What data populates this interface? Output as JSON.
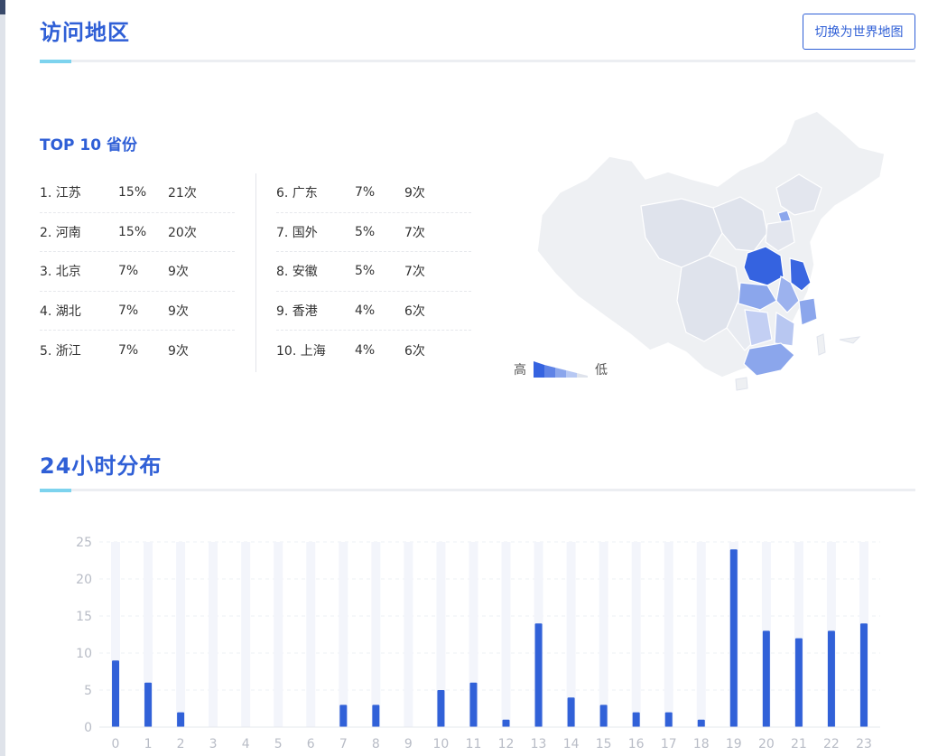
{
  "region": {
    "title": "访问地区",
    "switch_button": "切换为世界地图",
    "top10_title": "TOP 10 省份",
    "provinces": [
      {
        "name": "1. 江苏",
        "pct": "15%",
        "count": "21次"
      },
      {
        "name": "2. 河南",
        "pct": "15%",
        "count": "20次"
      },
      {
        "name": "3. 北京",
        "pct": "7%",
        "count": "9次"
      },
      {
        "name": "4. 湖北",
        "pct": "7%",
        "count": "9次"
      },
      {
        "name": "5. 浙江",
        "pct": "7%",
        "count": "9次"
      },
      {
        "name": "6. 广东",
        "pct": "7%",
        "count": "9次"
      },
      {
        "name": "7. 国外",
        "pct": "5%",
        "count": "7次"
      },
      {
        "name": "8. 安徽",
        "pct": "5%",
        "count": "7次"
      },
      {
        "name": "9. 香港",
        "pct": "4%",
        "count": "6次"
      },
      {
        "name": "10. 上海",
        "pct": "4%",
        "count": "6次"
      }
    ],
    "legend": {
      "high": "高",
      "low": "低"
    },
    "colors": {
      "accent": "#2f5fd6",
      "bar": "#3161d8",
      "map_high": "#3563e0",
      "map_mid": "#8ba6ec",
      "map_light": "#dfe3ec",
      "map_base": "#eef0f3"
    }
  },
  "hourly": {
    "title": "24小时分布"
  },
  "chart_data": {
    "type": "bar",
    "categories": [
      "0",
      "1",
      "2",
      "3",
      "4",
      "5",
      "6",
      "7",
      "8",
      "9",
      "10",
      "11",
      "12",
      "13",
      "14",
      "15",
      "16",
      "17",
      "18",
      "19",
      "20",
      "21",
      "22",
      "23"
    ],
    "values": [
      9,
      6,
      2,
      0,
      0,
      0,
      0,
      3,
      3,
      0,
      5,
      6,
      1,
      14,
      4,
      3,
      2,
      2,
      1,
      24,
      13,
      12,
      13,
      14
    ],
    "ylim": [
      0,
      25
    ],
    "yticks": [
      "0",
      "5",
      "10",
      "15",
      "20",
      "25"
    ],
    "grid": true
  }
}
